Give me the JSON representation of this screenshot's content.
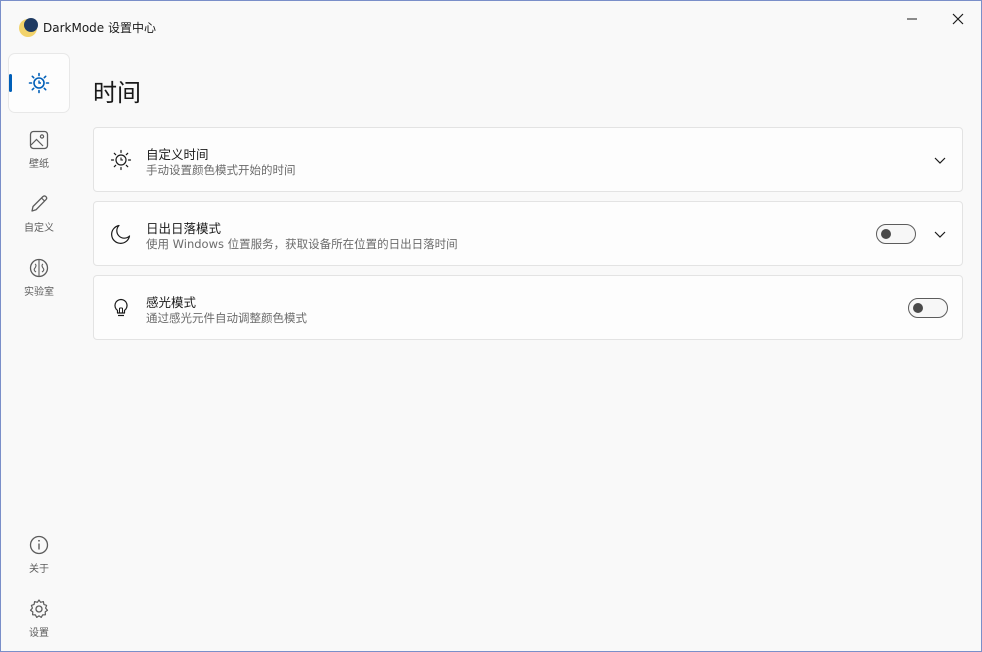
{
  "window": {
    "title": "DarkMode 设置中心",
    "buttons": {
      "minimize": "minimize-icon",
      "close": "close-icon"
    }
  },
  "sidebar": {
    "items": [
      {
        "label": "",
        "icon": "sun-clock-icon",
        "active": true
      },
      {
        "label": "壁纸",
        "icon": "wallpaper-icon"
      },
      {
        "label": "自定义",
        "icon": "pen-icon"
      },
      {
        "label": "实验室",
        "icon": "brain-icon"
      }
    ],
    "bottom": [
      {
        "label": "关于",
        "icon": "info-icon"
      },
      {
        "label": "设置",
        "icon": "gear-icon"
      }
    ]
  },
  "main": {
    "title": "时间",
    "cards": [
      {
        "title": "自定义时间",
        "desc": "手动设置颜色模式开始的时间",
        "icon": "sun-clock-icon",
        "toggle": null,
        "expandable": true
      },
      {
        "title": "日出日落模式",
        "desc": "使用 Windows 位置服务，获取设备所在位置的日出日落时间",
        "icon": "moon-icon",
        "toggle": false,
        "expandable": true
      },
      {
        "title": "感光模式",
        "desc": "通过感光元件自动调整颜色模式",
        "icon": "lightbulb-icon",
        "toggle": false,
        "expandable": false
      }
    ]
  },
  "colors": {
    "accent": "#005fb8",
    "background": "#f9f9f9",
    "card": "#fdfdfd"
  }
}
